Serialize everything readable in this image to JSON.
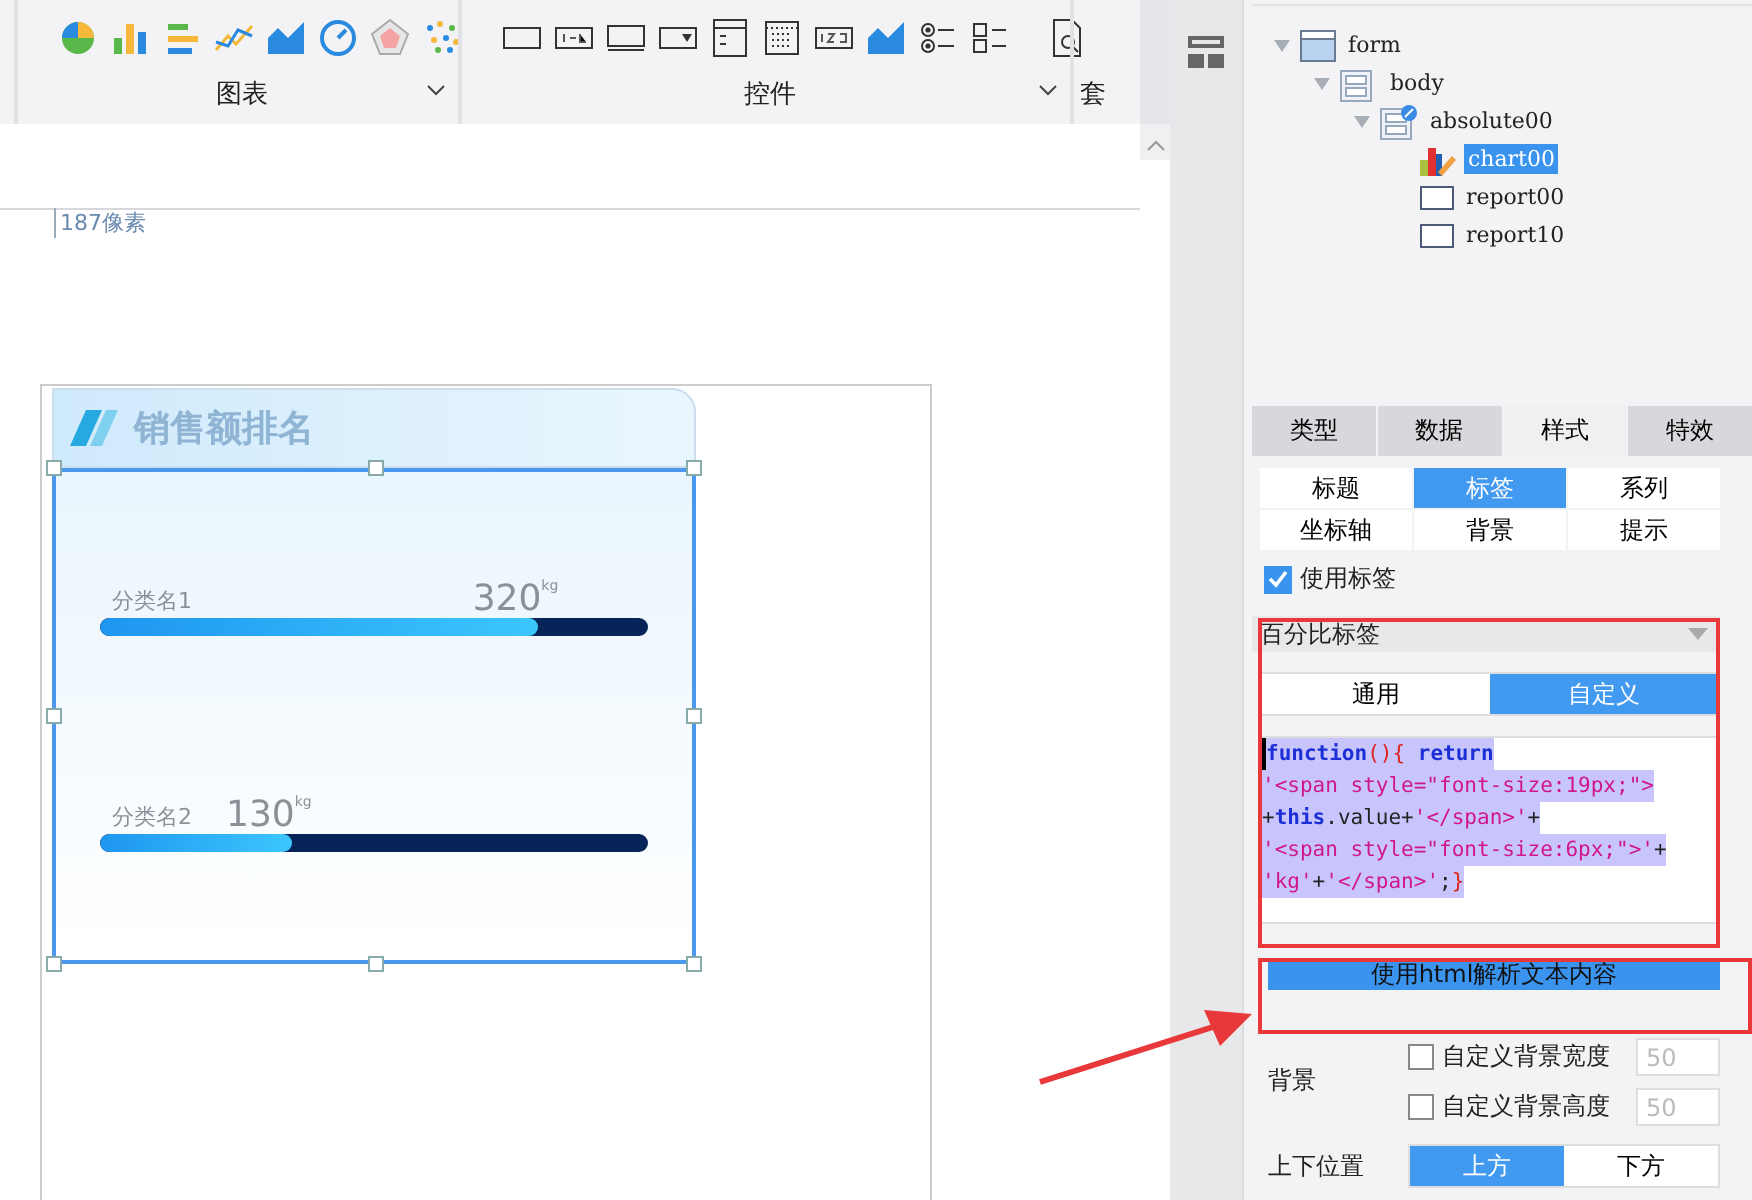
{
  "toolbar": {
    "groups": [
      {
        "label": "图表",
        "kind": "charts"
      },
      {
        "label": "控件",
        "kind": "widgets"
      },
      {
        "label": "套",
        "kind": "cut"
      }
    ]
  },
  "canvas": {
    "ruler_label": "187像素",
    "chart": {
      "title": "销售额排名",
      "rows": [
        {
          "category": "分类名1",
          "value": "320",
          "unit": "kg",
          "level": 0.8
        },
        {
          "category": "分类名2",
          "value": "130",
          "unit": "kg",
          "level": 0.35
        }
      ]
    }
  },
  "tree": [
    {
      "label": "form",
      "kind": "form",
      "expanded": true,
      "children": [
        {
          "label": "body",
          "kind": "layout",
          "expanded": true,
          "children": [
            {
              "label": "absolute00",
              "kind": "absolute",
              "expanded": true,
              "children": [
                {
                  "label": "chart00",
                  "kind": "chart",
                  "selected": true
                },
                {
                  "label": "report00",
                  "kind": "report",
                  "selected": false
                },
                {
                  "label": "report10",
                  "kind": "report",
                  "selected": false
                }
              ]
            }
          ]
        }
      ]
    }
  ],
  "tabs": [
    {
      "label": "类型",
      "selected": false
    },
    {
      "label": "数据",
      "selected": false
    },
    {
      "label": "样式",
      "selected": true
    },
    {
      "label": "特效",
      "selected": false
    }
  ],
  "subtabs": [
    {
      "label": "标题",
      "selected": false
    },
    {
      "label": "标签",
      "selected": true
    },
    {
      "label": "系列",
      "selected": false
    },
    {
      "label": "坐标轴",
      "selected": false
    },
    {
      "label": "背景",
      "selected": false
    },
    {
      "label": "提示",
      "selected": false
    }
  ],
  "use_label": {
    "label": "使用标签",
    "checked": true
  },
  "section": {
    "title": "百分比标签",
    "mode_tabs": [
      {
        "label": "通用",
        "selected": false
      },
      {
        "label": "自定义",
        "selected": true
      }
    ],
    "code": [
      [
        {
          "kind": "keyword",
          "text": "function"
        },
        {
          "kind": "paren",
          "text": "(){"
        },
        {
          "kind": "keyword",
          "text": " return"
        }
      ],
      [
        {
          "kind": "string",
          "text": "'<span style=\"font-size:19px;\">"
        }
      ],
      [
        {
          "kind": "plain",
          "text": "+"
        },
        {
          "kind": "keyword",
          "text": "this"
        },
        {
          "kind": "plain",
          "text": ".value+"
        },
        {
          "kind": "string",
          "text": "'</span>'"
        },
        {
          "kind": "plain",
          "text": "+"
        }
      ],
      [
        {
          "kind": "string",
          "text": "'<span style=\"font-size:6px;\">'"
        },
        {
          "kind": "plain",
          "text": "+"
        }
      ],
      [
        {
          "kind": "string",
          "text": "'kg'"
        },
        {
          "kind": "plain",
          "text": "+"
        },
        {
          "kind": "string",
          "text": "'</span>'"
        },
        {
          "kind": "plain",
          "text": ";"
        },
        {
          "kind": "paren",
          "text": "}"
        }
      ]
    ]
  },
  "html_button": "使用html解析文本内容",
  "background": {
    "label": "背景",
    "options": [
      {
        "label": "自定义背景宽度",
        "checked": false,
        "value": "50"
      },
      {
        "label": "自定义背景高度",
        "checked": false,
        "value": "50"
      }
    ]
  },
  "position": {
    "label": "上下位置",
    "options": [
      {
        "label": "上方",
        "selected": true
      },
      {
        "label": "下方",
        "selected": false
      }
    ]
  }
}
